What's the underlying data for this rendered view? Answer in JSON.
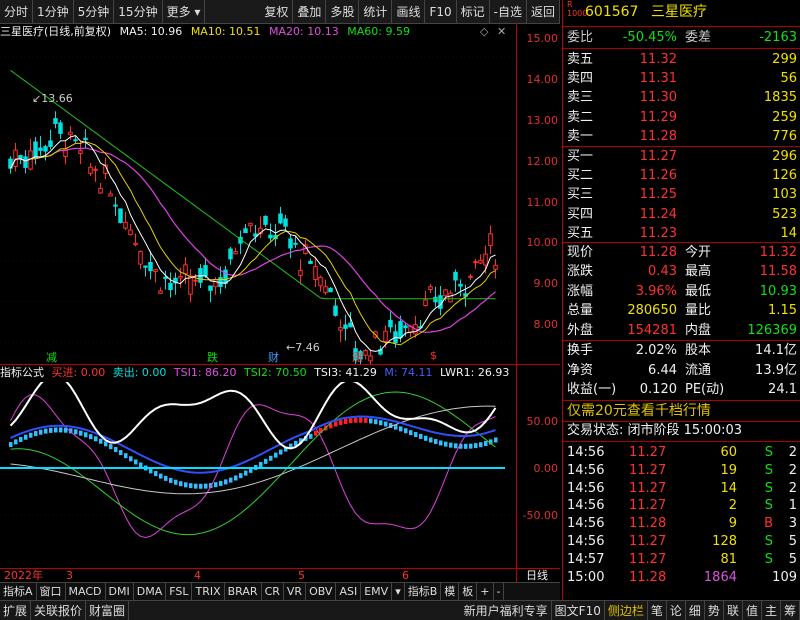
{
  "toolbar": {
    "left": [
      "分时",
      "1分钟",
      "5分钟",
      "15分钟",
      "更多"
    ],
    "right": [
      "复权",
      "叠加",
      "多股",
      "统计",
      "画线",
      "F10",
      "标记",
      "-自选",
      "返回"
    ]
  },
  "info": {
    "title": "三星医疗(日线,前复权)",
    "ma5": "MA5: 10.96",
    "ma10": "MA10: 10.51",
    "ma20": "MA20: 10.13",
    "ma60": "MA60: 9.59"
  },
  "price_axis": [
    "15.00",
    "14.00",
    "13.00",
    "12.00",
    "11.00",
    "10.00",
    "9.00",
    "8.00"
  ],
  "price_annotations": {
    "high": "13.66",
    "low": "7.46"
  },
  "events": [
    "减",
    "跌",
    "财",
    "涨",
    "$"
  ],
  "indicator": {
    "name": "指标公式",
    "buy": "买进: 0.00",
    "sell": "卖出: 0.00",
    "tsi1": "TSI1: 86.20",
    "tsi2": "TSI2: 70.50",
    "tsi3": "TSI3: 41.29",
    "m": "M: 74.11",
    "lwr1": "LWR1: 26.93"
  },
  "ind_axis": [
    "50.00",
    "0.00",
    "-50.00"
  ],
  "date_axis": {
    "year": "2022年",
    "months": [
      "3",
      "4",
      "5",
      "6"
    ],
    "mode": "日线"
  },
  "bottom_tabs": [
    "指标A",
    "窗口",
    "MACD",
    "DMI",
    "DMA",
    "FSL",
    "TRIX",
    "BRAR",
    "CR",
    "VR",
    "OBV",
    "ASI",
    "EMV",
    "指标B",
    "模",
    "板",
    "+",
    "-"
  ],
  "status_bar": {
    "left": [
      "扩展",
      "关联报价",
      "财富圈"
    ],
    "right": [
      "新用户福利专享",
      "图文F10",
      "侧边栏"
    ],
    "icons": [
      "笔",
      "论",
      "细",
      "势",
      "联",
      "值",
      "主",
      "筹"
    ]
  },
  "quote": {
    "code": "601567",
    "name": "三星医疗",
    "weibi_label": "委比",
    "weibi": "-50.45%",
    "weicha_label": "委差",
    "weicha": "-2163",
    "sells": [
      {
        "label": "卖五",
        "price": "11.32",
        "vol": "299"
      },
      {
        "label": "卖四",
        "price": "11.31",
        "vol": "56"
      },
      {
        "label": "卖三",
        "price": "11.30",
        "vol": "1835"
      },
      {
        "label": "卖二",
        "price": "11.29",
        "vol": "259"
      },
      {
        "label": "卖一",
        "price": "11.28",
        "vol": "776"
      }
    ],
    "buys": [
      {
        "label": "买一",
        "price": "11.27",
        "vol": "296"
      },
      {
        "label": "买二",
        "price": "11.26",
        "vol": "126"
      },
      {
        "label": "买三",
        "price": "11.25",
        "vol": "103"
      },
      {
        "label": "买四",
        "price": "11.24",
        "vol": "523"
      },
      {
        "label": "买五",
        "price": "11.23",
        "vol": "14"
      }
    ],
    "stats": [
      {
        "l1": "现价",
        "v1": "11.28",
        "l2": "今开",
        "v2": "11.32"
      },
      {
        "l1": "涨跌",
        "v1": "0.43",
        "l2": "最高",
        "v2": "11.58"
      },
      {
        "l1": "涨幅",
        "v1": "3.96%",
        "l2": "最低",
        "v2": "10.93"
      },
      {
        "l1": "总量",
        "v1": "280650",
        "l2": "量比",
        "v2": "1.15"
      },
      {
        "l1": "外盘",
        "v1": "154281",
        "l2": "内盘",
        "v2": "126369"
      }
    ],
    "stats2": [
      {
        "l1": "换手",
        "v1": "2.02%",
        "l2": "股本",
        "v2": "14.1亿"
      },
      {
        "l1": "净资",
        "v1": "6.44",
        "l2": "流通",
        "v2": "13.9亿"
      },
      {
        "l1": "收益(一)",
        "v1": "0.120",
        "l2": "PE(动)",
        "v2": "24.1"
      }
    ],
    "promo": "仅需20元查看千档行情",
    "trade_state": "交易状态: 闭市阶段 15:00:03",
    "ticks": [
      {
        "t": "14:56",
        "p": "11.27",
        "v": "60",
        "s": "S",
        "n": "2"
      },
      {
        "t": "14:56",
        "p": "11.27",
        "v": "19",
        "s": "S",
        "n": "2"
      },
      {
        "t": "14:56",
        "p": "11.27",
        "v": "14",
        "s": "S",
        "n": "2"
      },
      {
        "t": "14:56",
        "p": "11.27",
        "v": "2",
        "s": "S",
        "n": "1"
      },
      {
        "t": "14:56",
        "p": "11.28",
        "v": "9",
        "s": "B",
        "n": "3"
      },
      {
        "t": "14:56",
        "p": "11.27",
        "v": "128",
        "s": "S",
        "n": "5"
      },
      {
        "t": "14:57",
        "p": "11.27",
        "v": "81",
        "s": "S",
        "n": "5"
      },
      {
        "t": "15:00",
        "p": "11.28",
        "v": "1864",
        "s": "",
        "n": "109"
      }
    ]
  }
}
